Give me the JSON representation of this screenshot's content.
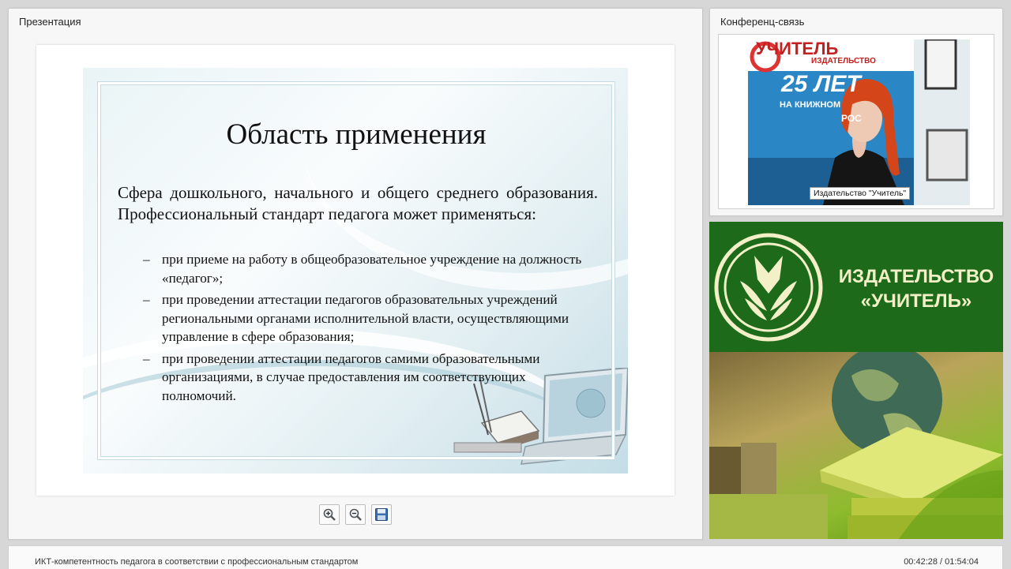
{
  "presentation": {
    "panel_title": "Презентация",
    "slide": {
      "heading": "Область применения",
      "intro": "Сфера дошкольного, начального и общего среднего образования. Профессиональный стандарт педагога может применяться:",
      "bullets": [
        "при приеме на работу в общеобразовательное учреждение на должность «педагог»;",
        "при проведении аттестации педагогов образовательных учреждений региональными органами исполнительной власти, осуществляющими управление в сфере образования;",
        "при проведении аттестации педагогов самими образовательными организациями, в случае предоставления им соответствующих полномочий."
      ],
      "bullet_marker": "–"
    },
    "toolbar": [
      {
        "name": "zoom-in-button",
        "icon": "zoom-in-icon"
      },
      {
        "name": "zoom-out-button",
        "icon": "zoom-out-icon"
      },
      {
        "name": "save-button",
        "icon": "floppy-disk-icon"
      }
    ]
  },
  "conference": {
    "panel_title": "Конференц-связь",
    "video_caption": "Издательство \"Учитель\"",
    "background_poster": {
      "brand": "УЧИТЕЛЬ",
      "subbrand": "ИЗДАТЕЛЬСТВО",
      "years": "25 ЛЕТ",
      "tagline": "НА КНИЖНОМ",
      "tagline2": "РОС"
    }
  },
  "banner": {
    "line1": "ИЗДАТЕЛЬСТВО",
    "line2": "«УЧИТЕЛЬ»",
    "colors": {
      "green": "#1d6b1a",
      "text": "#f3f0c8"
    }
  },
  "footer": {
    "title": "ИКТ-компетентность педагога в соответствии с профессиональным стандартом",
    "time": "00:42:28 / 01:54:04"
  }
}
